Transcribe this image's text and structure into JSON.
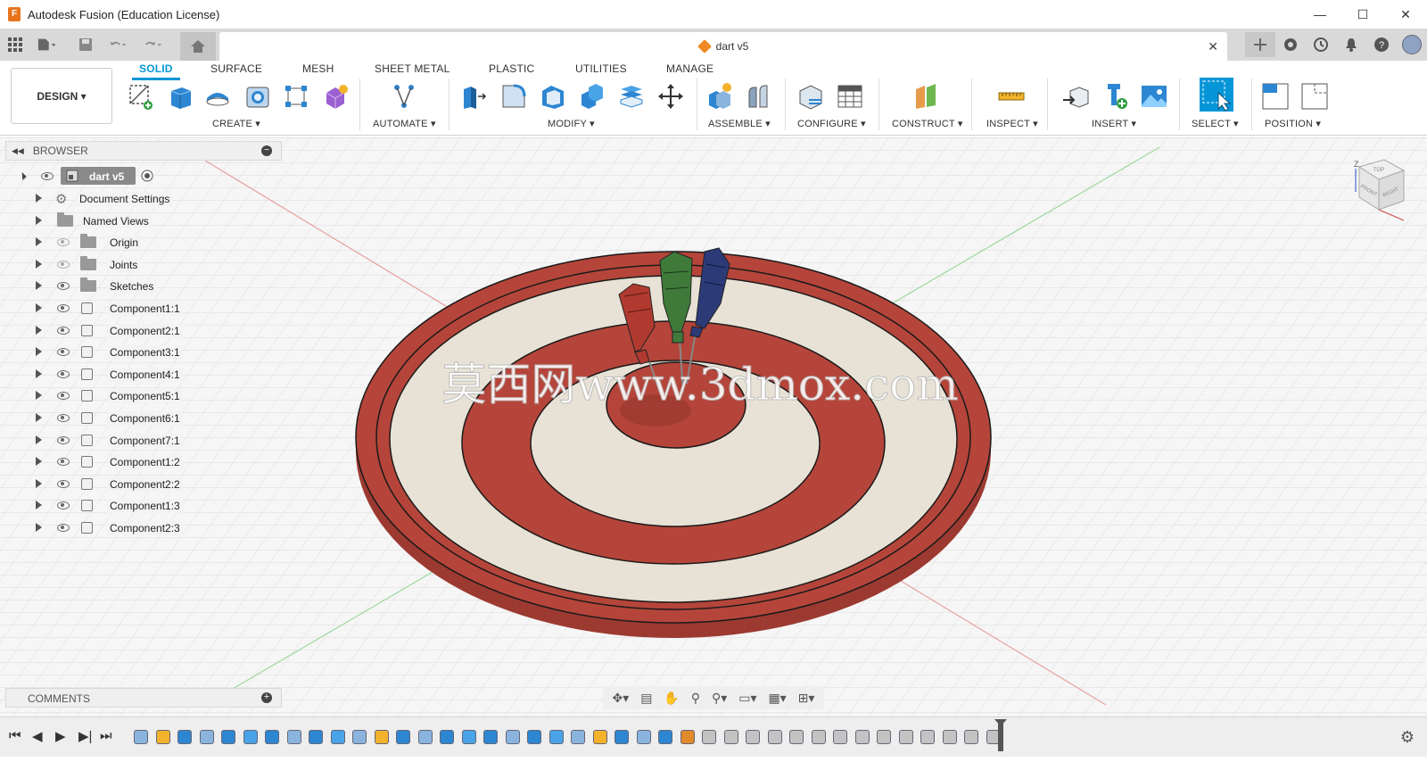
{
  "window": {
    "title": "Autodesk Fusion (Education License)",
    "logo": "F",
    "controls": [
      "—",
      "☐",
      "✕"
    ]
  },
  "document": {
    "tab_name": "dart v5",
    "close": "✕"
  },
  "ribbon": {
    "workspace": "DESIGN ▾",
    "tabs": [
      "SOLID",
      "SURFACE",
      "MESH",
      "SHEET METAL",
      "PLASTIC",
      "UTILITIES",
      "MANAGE"
    ],
    "active_tab": "SOLID",
    "groups": [
      "CREATE ▾",
      "AUTOMATE ▾",
      "MODIFY ▾",
      "ASSEMBLE ▾",
      "CONFIGURE ▾",
      "CONSTRUCT ▾",
      "INSPECT ▾",
      "INSERT ▾",
      "SELECT ▾",
      "POSITION ▾"
    ],
    "accent": "#0696d7"
  },
  "browser": {
    "title": "BROWSER",
    "root": "dart v5",
    "items": [
      {
        "label": "Document Settings",
        "icon": "gear-icon",
        "visible": true
      },
      {
        "label": "Named Views",
        "icon": "folder-icon",
        "visible": true
      },
      {
        "label": "Origin",
        "icon": "folder-icon",
        "visible": false
      },
      {
        "label": "Joints",
        "icon": "folder-icon",
        "visible": false
      },
      {
        "label": "Sketches",
        "icon": "folder-icon",
        "visible": true
      },
      {
        "label": "Component1:1",
        "icon": "component-icon",
        "visible": true
      },
      {
        "label": "Component2:1",
        "icon": "component-icon",
        "visible": true
      },
      {
        "label": "Component3:1",
        "icon": "component-icon",
        "visible": true
      },
      {
        "label": "Component4:1",
        "icon": "component-icon",
        "visible": true
      },
      {
        "label": "Component5:1",
        "icon": "component-icon",
        "visible": true
      },
      {
        "label": "Component6:1",
        "icon": "component-icon",
        "visible": true
      },
      {
        "label": "Component7:1",
        "icon": "component-icon",
        "visible": true
      },
      {
        "label": "Component1:2",
        "icon": "component-icon",
        "visible": true
      },
      {
        "label": "Component2:2",
        "icon": "component-icon",
        "visible": true
      },
      {
        "label": "Component1:3",
        "icon": "component-icon",
        "visible": true
      },
      {
        "label": "Component2:3",
        "icon": "component-icon",
        "visible": true
      }
    ]
  },
  "comments": {
    "title": "COMMENTS"
  },
  "viewport": {
    "watermark": "莫西网www.3dmox.com",
    "board_colors": {
      "red": "#b5453a",
      "cream": "#e8e2d6",
      "edge": "#1a1a1a"
    },
    "dart_colors": [
      "#b03a30",
      "#3f7a3a",
      "#2c3a78"
    ]
  },
  "viewcube": {
    "top": "TOP",
    "front": "FRONT",
    "right": "RIGHT",
    "axis": "Z"
  },
  "timeline": {
    "controls": [
      "⏮",
      "◀",
      "▶",
      "▶|",
      "⏭"
    ],
    "settings": "⚙"
  }
}
